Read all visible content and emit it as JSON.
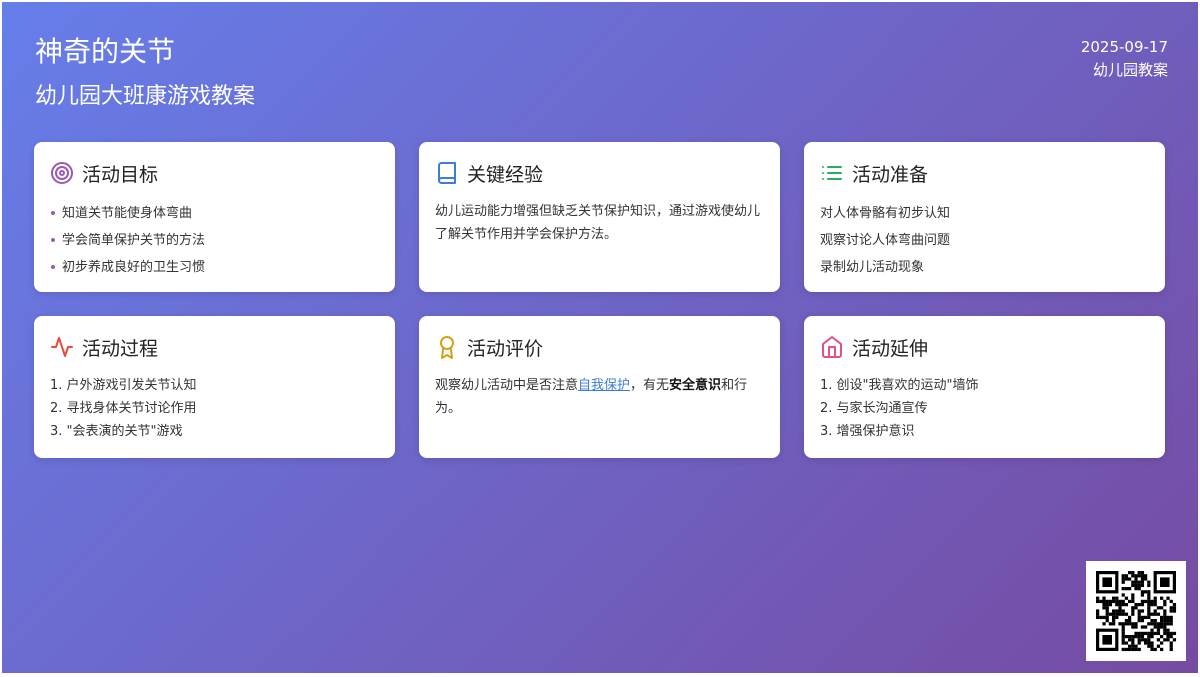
{
  "header": {
    "title": "神奇的关节",
    "subtitle": "幼儿园大班康游戏教案",
    "date": "2025-09-17",
    "doc_type": "幼儿园教案"
  },
  "cards": {
    "goals": {
      "icon": "target-icon",
      "title": "活动目标",
      "items": [
        "知道关节能使身体弯曲",
        "学会简单保护关节的方法",
        "初步养成良好的卫生习惯"
      ]
    },
    "experience": {
      "icon": "book-icon",
      "title": "关键经验",
      "text": "幼儿运动能力增强但缺乏关节保护知识，通过游戏使幼儿了解关节作用并学会保护方法。"
    },
    "prep": {
      "icon": "list-icon",
      "title": "活动准备",
      "items": [
        "对人体骨骼有初步认知",
        "观察讨论人体弯曲问题",
        "录制幼儿活动现象"
      ]
    },
    "process": {
      "icon": "pulse-icon",
      "title": "活动过程",
      "items": [
        "1. 户外游戏引发关节认知",
        "2. 寻找身体关节讨论作用",
        "3. \"会表演的关节\"游戏"
      ]
    },
    "evaluation": {
      "icon": "award-icon",
      "title": "活动评价",
      "text_before": "观察幼儿活动中是否注意",
      "link": "自我保护",
      "text_mid": "，有无",
      "bold": "安全意识",
      "text_after": "和行为。"
    },
    "extension": {
      "icon": "home-icon",
      "title": "活动延伸",
      "items": [
        "1. 创设\"我喜欢的运动\"墙饰",
        "2. 与家长沟通宣传",
        "3. 增强保护意识"
      ]
    }
  },
  "qr": {
    "icon": "qr-code-icon"
  },
  "colors": {
    "gradient_start": "#667eea",
    "gradient_end": "#764ba2",
    "target": "#9b59b6",
    "book": "#3b7dd8",
    "list": "#27ae60",
    "pulse": "#e74c3c",
    "award": "#d4a017",
    "home": "#e0508a"
  }
}
